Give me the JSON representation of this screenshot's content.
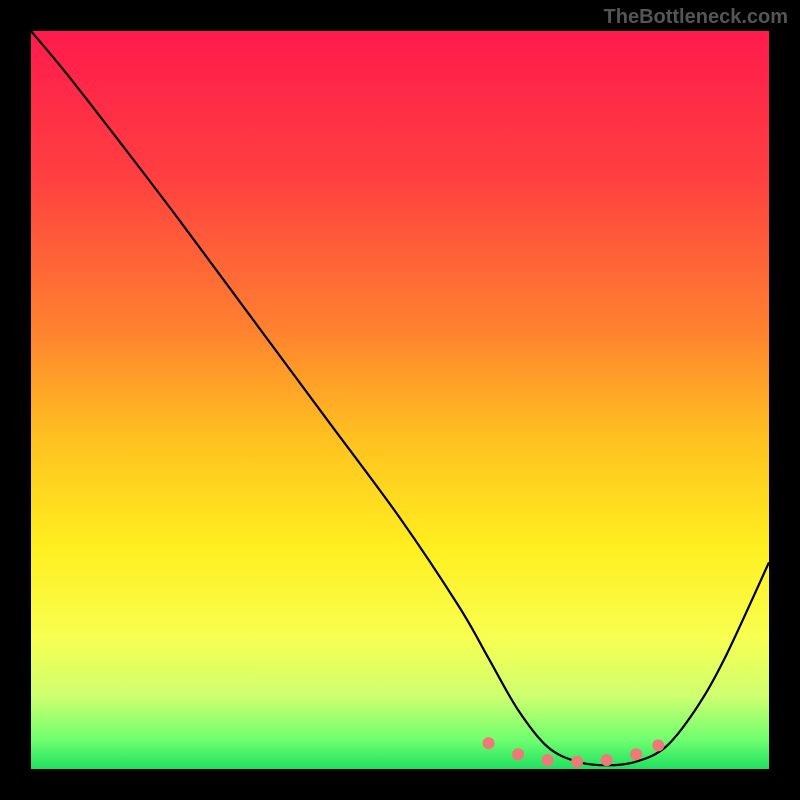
{
  "watermark": "TheBottleneck.com",
  "chart_data": {
    "type": "line",
    "title": "",
    "xlabel": "",
    "ylabel": "",
    "xlim": [
      0,
      100
    ],
    "ylim": [
      0,
      100
    ],
    "series": [
      {
        "name": "curve",
        "x": [
          0,
          5,
          12,
          20,
          30,
          40,
          50,
          58,
          62,
          66,
          70,
          74,
          78,
          82,
          86,
          90,
          94,
          100
        ],
        "y": [
          100,
          94,
          85,
          74.5,
          61,
          47.5,
          34,
          22,
          15,
          8,
          3,
          1,
          0.5,
          1,
          3,
          8,
          15,
          28
        ]
      }
    ],
    "markers": {
      "name": "highlight-dots",
      "color": "#f07878",
      "points": [
        {
          "x": 62,
          "y": 3.5
        },
        {
          "x": 66,
          "y": 2.0
        },
        {
          "x": 70,
          "y": 1.2
        },
        {
          "x": 74,
          "y": 1.0
        },
        {
          "x": 78,
          "y": 1.2
        },
        {
          "x": 82,
          "y": 2.0
        },
        {
          "x": 85,
          "y": 3.2
        }
      ]
    },
    "gradient_stops": [
      {
        "offset": 0,
        "color": "#ff1a4d"
      },
      {
        "offset": 20,
        "color": "#ff4040"
      },
      {
        "offset": 40,
        "color": "#ff8030"
      },
      {
        "offset": 55,
        "color": "#ffc020"
      },
      {
        "offset": 70,
        "color": "#ffef20"
      },
      {
        "offset": 82,
        "color": "#f8ff50"
      },
      {
        "offset": 90,
        "color": "#d0ff70"
      },
      {
        "offset": 96,
        "color": "#70ff70"
      },
      {
        "offset": 100,
        "color": "#20e060"
      }
    ]
  }
}
